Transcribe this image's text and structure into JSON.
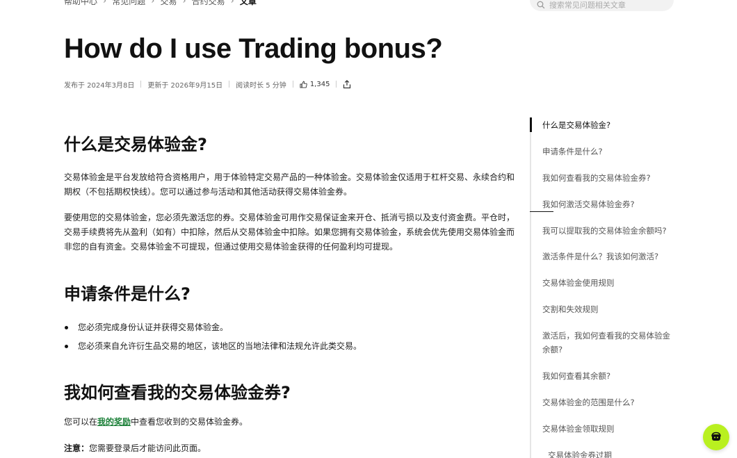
{
  "breadcrumb": [
    "帮助中心",
    "常见问题",
    "交易",
    "合约交易",
    "文章"
  ],
  "search": {
    "placeholder": "搜索常见问题相关文章"
  },
  "article": {
    "title": "How do I use Trading bonus?",
    "meta": {
      "published": "发布于 2024年3月8日",
      "updated": "更新于 2026年9月15日",
      "read_time": "阅读时长 5 分钟",
      "likes": "1,345"
    },
    "sections": {
      "s1_heading": "什么是交易体验金?",
      "s1_p1": "交易体验金是平台发放给符合资格用户，用于体验特定交易产品的一种体验金。交易体验金仅适用于杠杆交易、永续合约和期权（不包括期权快线）。您可以通过参与活动和其他活动获得交易体验金券。",
      "s1_p2": "要使用您的交易体验金，您必须先激活您的券。交易体验金可用作交易保证金来开仓、抵消亏损以及支付资金费。平仓时，交易手续费将先从盈利（如有）中扣除，然后从交易体验金中扣除。如果您拥有交易体验金，系统会优先使用交易体验金而非您的自有资金。交易体验金不可提现，但通过使用交易体验金获得的任何盈利均可提现。",
      "s2_heading": "申请条件是什么?",
      "s2_bullets": [
        "您必须完成身份认证并获得交易体验金。",
        "您必须来自允许衍生品交易的地区，该地区的当地法律和法规允许此类交易。"
      ],
      "s3_heading": "我如何查看我的交易体验金券?",
      "s3_p_before": "您可以在",
      "s3_link": "我的奖励",
      "s3_p_after": "中查看您收到的交易体验金券。",
      "note_label": "注意：",
      "note_text": "您需要登录后才能访问此页面。"
    }
  },
  "toc": {
    "items": [
      "什么是交易体验金?",
      "申请条件是什么?",
      "我如何查看我的交易体验金券?",
      "我如何激活交易体验金券?",
      "我可以提取我的交易体验金余额吗?",
      "激活条件是什么？我该如何激活?",
      "交易体验金使用规则",
      "交割和失效规则",
      "激活后，我如何查看我的交易体验金余额?",
      "我如何查看其余额?",
      "交易体验金的范围是什么?",
      "交易体验金领取规则",
      "交易体验金券过期"
    ],
    "active_index": 0
  },
  "icons": {
    "search": "search-icon",
    "chevron": "chevron-right-icon",
    "like": "thumbs-up-icon",
    "share": "share-icon",
    "support": "headset-icon"
  },
  "colors": {
    "accent_green": "#1a7f37",
    "fab_lime": "#b9f020"
  }
}
